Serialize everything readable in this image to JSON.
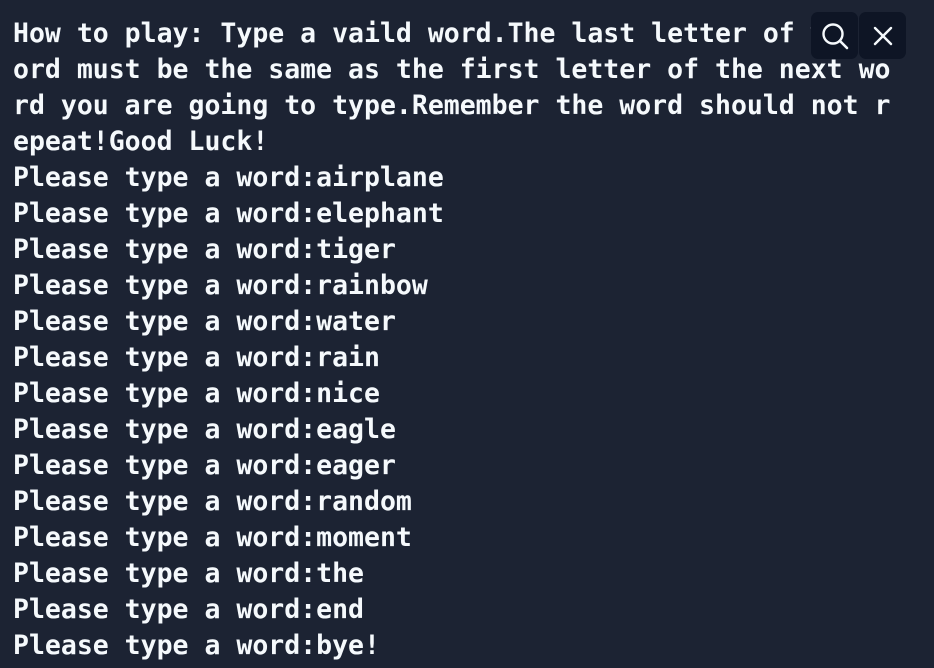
{
  "console": {
    "lines": [
      "How to play: Type a vaild word.The last letter of w",
      "ord must be the same as the first letter of the next wo",
      "rd you are going to type.Remember the word should not r",
      "epeat!Good Luck!",
      "Please type a word:airplane",
      "Please type a word:elephant",
      "Please type a word:tiger",
      "Please type a word:rainbow",
      "Please type a word:water",
      "Please type a word:rain",
      "Please type a word:nice",
      "Please type a word:eagle",
      "Please type a word:eager",
      "Please type a word:random",
      "Please type a word:moment",
      "Please type a word:the",
      "Please type a word:end",
      "Please type a word:bye!"
    ]
  },
  "toolbar": {
    "search_icon": "search-icon",
    "close_icon": "close-icon"
  },
  "colors": {
    "background": "#1c2333",
    "text": "#f5f9fc",
    "button_bg": "#0e1525"
  }
}
